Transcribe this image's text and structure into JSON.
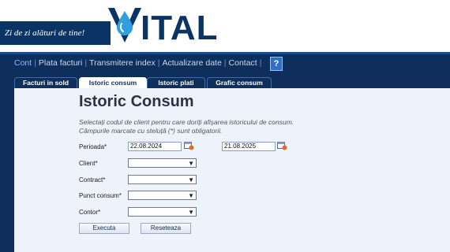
{
  "header": {
    "tagline": "Zi de zi alături de tine!",
    "logo_text": "ITAL",
    "colors": {
      "brand_dark": "#0b3466",
      "brand_light": "#2f9fe0",
      "nav_bg": "#0e2f5c"
    }
  },
  "nav": {
    "items": [
      {
        "label": "Cont",
        "active": true
      },
      {
        "label": "Plata facturi"
      },
      {
        "label": "Transmitere index"
      },
      {
        "label": "Actualizare date"
      },
      {
        "label": "Contact"
      }
    ],
    "help_icon": "help-icon"
  },
  "tabs": [
    {
      "label": "Facturi in sold"
    },
    {
      "label": "Istoric consum",
      "active": true
    },
    {
      "label": "Istoric plati"
    },
    {
      "label": "Grafic consum"
    }
  ],
  "main": {
    "title": "Istoric Consum",
    "instructions_line1": "Selectați codul de client pentru care doriți afișarea istoricului de consum.",
    "instructions_line2": "Câmpurile marcate cu steluță (*) sunt obligatorii.",
    "period_label": "Perioada*",
    "date_from": "22.08.2024",
    "date_to": "21.08.2025",
    "client_label": "Client*",
    "contract_label": "Contract*",
    "punct_label": "Punct consum*",
    "contor_label": "Contor*",
    "execute_label": "Executa",
    "reset_label": "Reseteaza"
  }
}
